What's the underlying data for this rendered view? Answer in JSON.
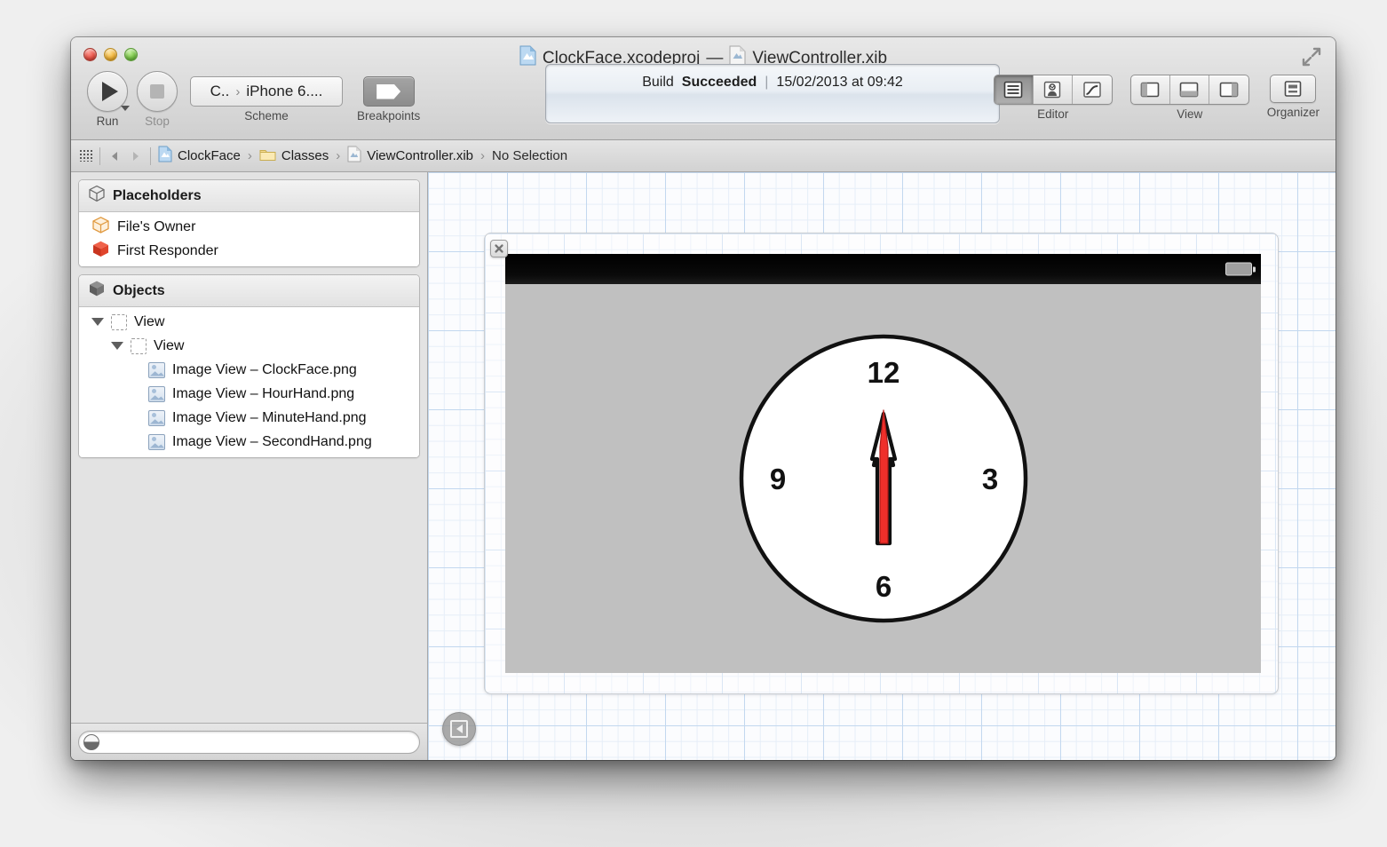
{
  "window": {
    "title_project": "ClockFace.xcodeproj",
    "title_separator": "—",
    "title_file": "ViewController.xib",
    "project_icon": "xcodeproj-icon",
    "file_icon": "xib-icon",
    "fullscreen_icon": "fullscreen-expand-icon",
    "traffic_lights": [
      "close",
      "minimize",
      "zoom"
    ]
  },
  "toolbar": {
    "run_label": "Run",
    "run_icon": "play-triangle-icon",
    "stop_label": "Stop",
    "stop_icon": "stop-square-icon",
    "scheme_label": "Scheme",
    "scheme_project": "C..",
    "scheme_chevron": "›",
    "scheme_destination": "iPhone 6....",
    "breakpoints_label": "Breakpoints",
    "breakpoints_icon": "breakpoint-flag-icon",
    "editor_label": "Editor",
    "view_label": "View",
    "organizer_label": "Organizer",
    "editor_segments": [
      {
        "name": "standard-editor",
        "icon": "standard-editor-icon",
        "active": true
      },
      {
        "name": "assistant-editor",
        "icon": "assistant-editor-icon",
        "active": false
      },
      {
        "name": "version-editor",
        "icon": "version-editor-icon",
        "active": false
      }
    ],
    "view_segments": [
      {
        "name": "toggle-navigator",
        "icon": "left-panel-icon",
        "active": false
      },
      {
        "name": "toggle-debug-area",
        "icon": "bottom-panel-icon",
        "active": false
      },
      {
        "name": "toggle-utilities",
        "icon": "right-panel-icon",
        "active": false
      }
    ],
    "organizer_icon": "organizer-icon"
  },
  "status_panel": {
    "build_prefix": "Build",
    "build_result": "Succeeded",
    "divider": "|",
    "timestamp": "15/02/2013 at 09:42"
  },
  "breadcrumb": {
    "grip_icon": "jump-bar-grip-icon",
    "back_icon": "back-arrow-icon",
    "forward_icon": "forward-arrow-icon",
    "chevron": "›",
    "items": [
      {
        "label": "ClockFace",
        "icon": "xcodeproj-icon"
      },
      {
        "label": "Classes",
        "icon": "folder-icon"
      },
      {
        "label": "ViewController.xib",
        "icon": "xib-icon"
      },
      {
        "label": "No Selection",
        "icon": "none"
      }
    ]
  },
  "sidebar": {
    "placeholders": {
      "title": "Placeholders",
      "header_icon": "wireframe-cube-icon",
      "items": [
        {
          "label": "File's Owner",
          "icon": "files-owner-cube-icon"
        },
        {
          "label": "First Responder",
          "icon": "first-responder-cube-icon"
        }
      ]
    },
    "objects": {
      "title": "Objects",
      "header_icon": "solid-cube-icon",
      "tree": [
        {
          "label": "View",
          "icon": "view-dashed-square-icon",
          "depth": 0,
          "expanded": true
        },
        {
          "label": "View",
          "icon": "view-dashed-square-icon",
          "depth": 1,
          "expanded": true
        },
        {
          "label": "Image View – ClockFace.png",
          "icon": "image-view-icon",
          "depth": 2,
          "expanded": null
        },
        {
          "label": "Image View – HourHand.png",
          "icon": "image-view-icon",
          "depth": 2,
          "expanded": null
        },
        {
          "label": "Image View – MinuteHand.png",
          "icon": "image-view-icon",
          "depth": 2,
          "expanded": null
        },
        {
          "label": "Image View – SecondHand.png",
          "icon": "image-view-icon",
          "depth": 2,
          "expanded": null
        }
      ]
    },
    "filter": {
      "placeholder": "",
      "value": "",
      "icon": "filter-glyph-icon"
    }
  },
  "canvas": {
    "close_badge_icon": "close-x-icon",
    "toggle_icon": "collapse-panel-icon",
    "device": {
      "status_bar_battery_icon": "battery-icon",
      "background_color": "#c0c0c0"
    },
    "clock": {
      "face_color": "#ffffff",
      "border_color": "#111111",
      "numerals": [
        {
          "value": "12",
          "position": "top"
        },
        {
          "value": "3",
          "position": "right"
        },
        {
          "value": "6",
          "position": "bottom"
        },
        {
          "value": "9",
          "position": "left"
        }
      ],
      "hands": [
        {
          "name": "hour-hand",
          "color": "#ffffff",
          "outline": "#111111",
          "angle_deg": 0
        },
        {
          "name": "minute-hand",
          "color": "#ffffff",
          "outline": "#111111",
          "angle_deg": 0
        },
        {
          "name": "second-hand",
          "color": "#ee2222",
          "outline": "#111111",
          "angle_deg": 0
        }
      ]
    }
  }
}
